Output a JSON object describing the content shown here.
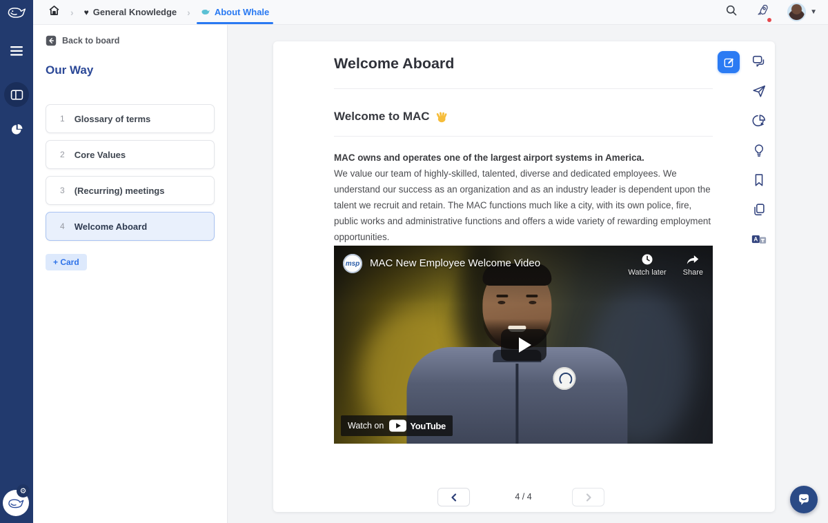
{
  "colors": {
    "accent_blue": "#2b7bf3",
    "navy": "#223a6e",
    "active_card_bg": "#e9f0fc"
  },
  "topbar": {
    "breadcrumb": {
      "heart": "♥",
      "separator": "›",
      "board_label": "General Knowledge",
      "card_label": "About Whale"
    },
    "icons": [
      "home",
      "search",
      "rocket",
      "avatar-menu",
      "chevron-down"
    ]
  },
  "nav_rail": {
    "icons": [
      "menu",
      "boards",
      "analytics"
    ],
    "footer_icons": [
      "whale",
      "gear"
    ]
  },
  "sidebar": {
    "back_label": "Back to board",
    "board_title": "Our Way",
    "cards": [
      {
        "num": "1",
        "label": "Glossary of terms",
        "active": false
      },
      {
        "num": "2",
        "label": "Core Values",
        "active": false
      },
      {
        "num": "3",
        "label": "(Recurring) meetings",
        "active": false
      },
      {
        "num": "4",
        "label": "Welcome Aboard",
        "active": true
      }
    ],
    "add_card_label": "+ Card"
  },
  "card": {
    "title": "Welcome Aboard",
    "heading": "Welcome to MAC",
    "heading_emoji": "👋",
    "intro_bold": "MAC owns and operates one of the largest airport systems in America.",
    "body": "We value our team of highly-skilled, talented, diverse and dedicated employees. We understand our success as an organization and as an industry leader is dependent upon the talent we recruit and retain. The MAC functions much like a city, with its own police, fire, public works and administrative functions and offers a wide variety of rewarding employment opportunities.",
    "pagination": {
      "label": "4 / 4"
    }
  },
  "video": {
    "channel": "msp",
    "title": "MAC New Employee Welcome Video",
    "watch_later_label": "Watch later",
    "share_label": "Share",
    "watch_on_label": "Watch on",
    "brand_label": "YouTube"
  },
  "right_rail": {
    "icons": [
      "comments",
      "send",
      "analytics",
      "lightbulb",
      "bookmark",
      "duplicate",
      "translate"
    ]
  }
}
